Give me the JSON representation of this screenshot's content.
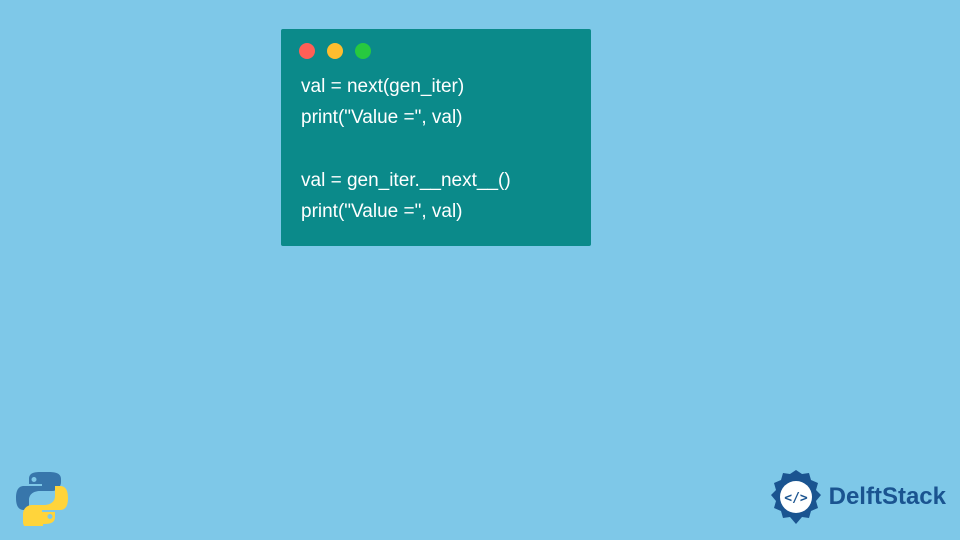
{
  "code": {
    "line1": "val = next(gen_iter)",
    "line2": "print(\"Value =\", val)",
    "line3": "",
    "line4": "val = gen_iter.__next__()",
    "line5": "print(\"Value =\", val)"
  },
  "brand": {
    "name": "DelftStack"
  }
}
